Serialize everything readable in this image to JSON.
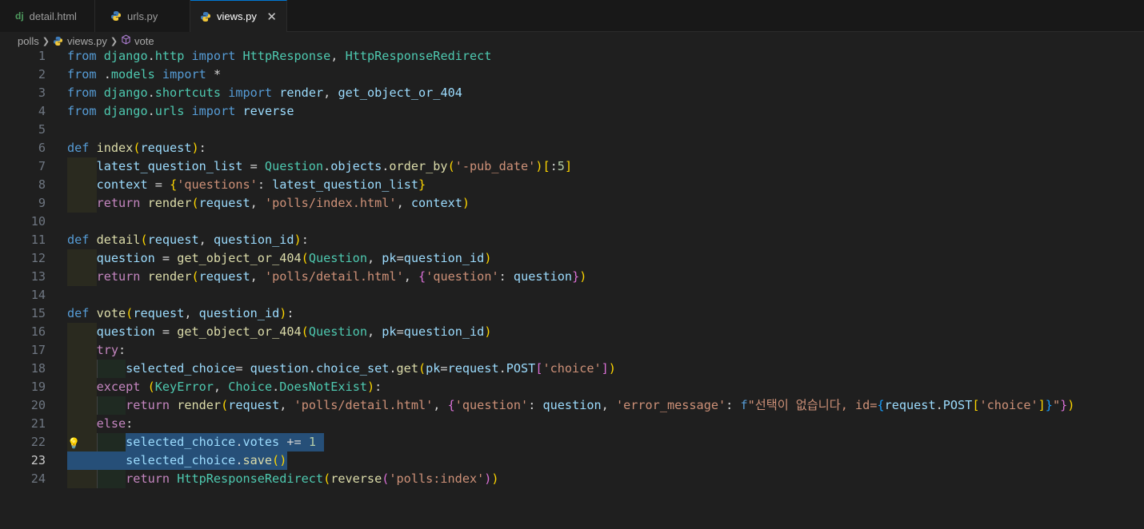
{
  "tabs": [
    {
      "label": "detail.html",
      "icon": "django-icon",
      "icon_text": "dj",
      "active": false
    },
    {
      "label": "urls.py",
      "icon": "python-icon",
      "active": false
    },
    {
      "label": "views.py",
      "icon": "python-icon",
      "active": true
    }
  ],
  "breadcrumb": {
    "folder": "polls",
    "file": "views.py",
    "symbol": "vote"
  },
  "editor": {
    "current_line": 23,
    "lines": [
      {
        "n": "1",
        "text": "from django.http import HttpResponse, HttpResponseRedirect"
      },
      {
        "n": "2",
        "text": "from .models import *"
      },
      {
        "n": "3",
        "text": "from django.shortcuts import render, get_object_or_404"
      },
      {
        "n": "4",
        "text": "from django.urls import reverse"
      },
      {
        "n": "5",
        "text": ""
      },
      {
        "n": "6",
        "text": "def index(request):"
      },
      {
        "n": "7",
        "text": "    latest_question_list = Question.objects.order_by('-pub_date')[:5]"
      },
      {
        "n": "8",
        "text": "    context = {'questions': latest_question_list}"
      },
      {
        "n": "9",
        "text": "    return render(request, 'polls/index.html', context)"
      },
      {
        "n": "10",
        "text": ""
      },
      {
        "n": "11",
        "text": "def detail(request, question_id):"
      },
      {
        "n": "12",
        "text": "    question = get_object_or_404(Question, pk=question_id)"
      },
      {
        "n": "13",
        "text": "    return render(request, 'polls/detail.html', {'question': question})"
      },
      {
        "n": "14",
        "text": ""
      },
      {
        "n": "15",
        "text": "def vote(request, question_id):"
      },
      {
        "n": "16",
        "text": "    question = get_object_or_404(Question, pk=question_id)"
      },
      {
        "n": "17",
        "text": "    try:"
      },
      {
        "n": "18",
        "text": "        selected_choice= question.choice_set.get(pk=request.POST['choice'])"
      },
      {
        "n": "19",
        "text": "    except (KeyError, Choice.DoesNotExist):"
      },
      {
        "n": "20",
        "text": "        return render(request, 'polls/detail.html', {'question': question, 'error_message': f\"선택이 없습니다, id={request.POST['choice']}\"})"
      },
      {
        "n": "21",
        "text": "    else:"
      },
      {
        "n": "22",
        "text": "        selected_choice.votes += 1"
      },
      {
        "n": "23",
        "text": "        selected_choice.save()"
      },
      {
        "n": "24",
        "text": "        return HttpResponseRedirect(reverse('polls:index'))"
      }
    ]
  },
  "colors": {
    "background": "#1f1f1f",
    "keyword": "#569cd6",
    "control": "#c586c0",
    "class": "#4ec9b0",
    "function": "#dcdcaa",
    "variable": "#9cdcfe",
    "string": "#ce9178",
    "number": "#b5cea8",
    "selection": "#264f78",
    "accent": "#0078d4"
  }
}
